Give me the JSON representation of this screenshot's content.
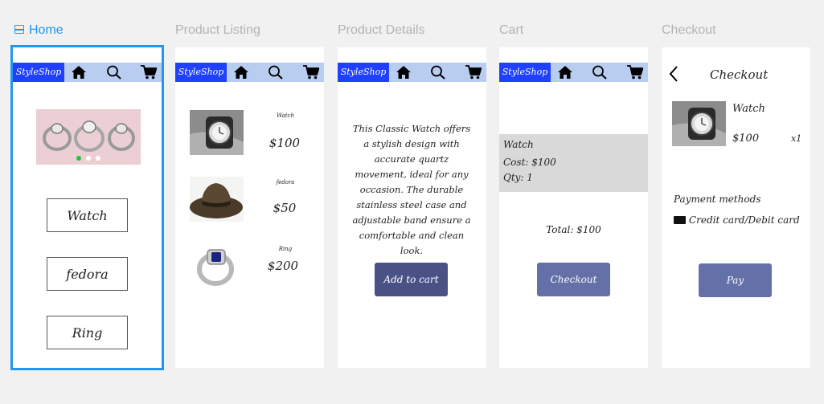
{
  "frames": [
    {
      "title": "Home"
    },
    {
      "title": "Product Listing"
    },
    {
      "title": "Product Details"
    },
    {
      "title": "Cart"
    },
    {
      "title": "Checkout"
    }
  ],
  "brand": "StyleShop",
  "icons": {
    "home": "home-icon",
    "search": "search-icon",
    "cart": "cart-icon",
    "back": "back-arrow-icon",
    "card": "credit-card-icon"
  },
  "colors": {
    "brand": "#1f40ff",
    "navbar": "#b8cdf0",
    "selection": "#2196f3",
    "button_primary": "#4a5285",
    "button_secondary": "#6470a8"
  },
  "home": {
    "carousel_dots": 3,
    "carousel_active": 0,
    "buttons": [
      "Watch",
      "fedora",
      "Ring"
    ]
  },
  "listing": {
    "products": [
      {
        "name": "Watch",
        "price": "$100"
      },
      {
        "name": "fedora",
        "price": "$50"
      },
      {
        "name": "Ring",
        "price": "$200"
      }
    ]
  },
  "details": {
    "description": "This Classic Watch offers a stylish design with accurate quartz movement, ideal for any occasion. The durable stainless steel case and adjustable band ensure a comfortable and clean look.",
    "button": "Add to cart"
  },
  "cart": {
    "item_name": "Watch",
    "cost": "Cost: $100",
    "qty": "Qty: 1",
    "total": "Total: $100",
    "button": "Checkout"
  },
  "checkout": {
    "title": "Checkout",
    "item_name": "Watch",
    "item_price": "$100",
    "item_qty": "x1",
    "payment_heading": "Payment methods",
    "payment_option": "Credit card/Debit card",
    "button": "Pay"
  }
}
